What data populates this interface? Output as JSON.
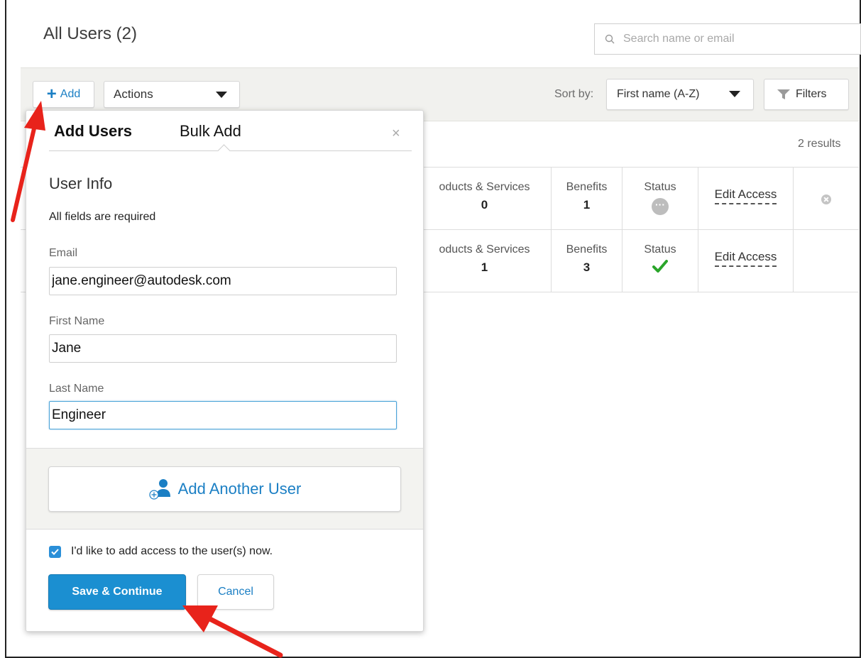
{
  "page": {
    "title": "All Users (2)",
    "search_placeholder": "Search name or email",
    "results_count": "2 results"
  },
  "toolbar": {
    "add_label": "Add",
    "actions_label": "Actions",
    "sort_by_label": "Sort by:",
    "sort_value": "First name (A-Z)",
    "filters_label": "Filters"
  },
  "table": {
    "rows": [
      {
        "products_label": "oducts & Services",
        "products_value": "0",
        "benefits_label": "Benefits",
        "benefits_value": "1",
        "status_label": "Status",
        "status_state": "pending",
        "edit_access_label": "Edit Access"
      },
      {
        "products_label": "oducts & Services",
        "products_value": "1",
        "benefits_label": "Benefits",
        "benefits_value": "3",
        "status_label": "Status",
        "status_state": "active",
        "edit_access_label": "Edit Access"
      }
    ]
  },
  "modal": {
    "tabs": [
      {
        "label": "Add Users",
        "active": true
      },
      {
        "label": "Bulk Add",
        "active": false
      }
    ],
    "close_symbol": "×",
    "section_title": "User Info",
    "required_note": "All fields are required",
    "fields": {
      "email": {
        "label": "Email",
        "value": "jane.engineer@autodesk.com"
      },
      "first_name": {
        "label": "First Name",
        "value": "Jane"
      },
      "last_name": {
        "label": "Last Name",
        "value": "Engineer"
      }
    },
    "add_another_label": "Add Another User",
    "consent_label": "I'd like to add access to the user(s) now.",
    "consent_checked": true,
    "save_label": "Save & Continue",
    "cancel_label": "Cancel"
  },
  "colors": {
    "accent": "#1b7fc4",
    "primary_button": "#1b8fd1",
    "annotation_arrow": "#e8231b",
    "status_ok": "#2aa52a",
    "status_pending": "#bdbdbd"
  },
  "icons": {
    "search": "search-icon",
    "filter": "filter-icon",
    "add_user": "add-user-icon",
    "remove": "remove-icon",
    "checkmark": "checkmark-icon"
  }
}
